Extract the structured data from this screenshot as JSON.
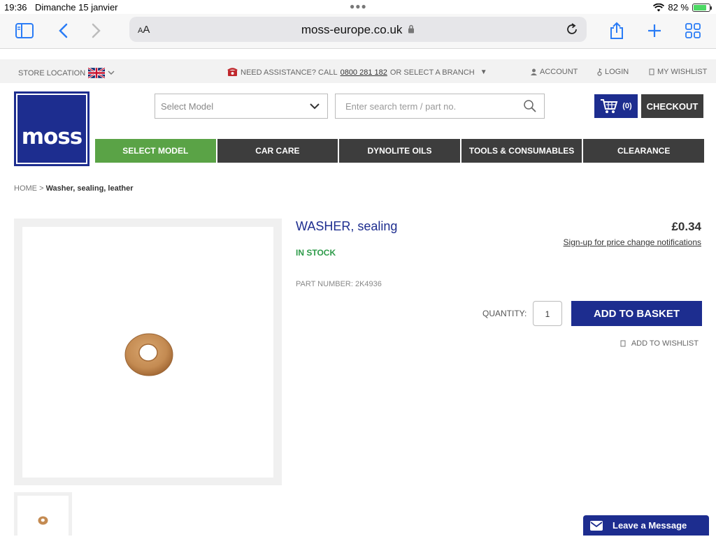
{
  "status": {
    "time": "19:36",
    "date": "Dimanche 15 janvier",
    "battery": "82 %",
    "battery_level": 0.82
  },
  "browser": {
    "text_size": "AA",
    "url": "moss-europe.co.uk"
  },
  "topbar": {
    "store_location": "STORE LOCATION",
    "assistance_prefix": "NEED ASSISTANCE? CALL",
    "phone": "0800 281 182",
    "assistance_suffix": "OR SELECT A BRANCH",
    "account": "ACCOUNT",
    "login": "LOGIN",
    "wishlist": "MY WISHLIST"
  },
  "header": {
    "logo": "moss",
    "select_model_placeholder": "Select Model",
    "search_placeholder": "Enter search term / part no.",
    "cart_count": "(0)",
    "checkout": "CHECKOUT"
  },
  "nav": {
    "items": [
      "SELECT MODEL",
      "CAR CARE",
      "DYNOLITE OILS",
      "TOOLS & CONSUMABLES",
      "CLEARANCE"
    ]
  },
  "breadcrumb": {
    "home": "HOME",
    "sep": ">",
    "current": "Washer, sealing, leather"
  },
  "product": {
    "title": "WASHER, sealing",
    "price": "£0.34",
    "price_notify": "Sign-up for price change notifications",
    "stock": "IN STOCK",
    "part_number": "PART NUMBER: 2K4936",
    "quantity_label": "QUANTITY:",
    "quantity": "1",
    "add_to_basket": "ADD TO BASKET",
    "add_to_wishlist": "ADD TO WISHLIST"
  },
  "chat": {
    "label": "Leave a Message"
  },
  "colors": {
    "brand_blue": "#1d2d8f",
    "nav_dark": "#3d3d3d",
    "nav_active": "#5aa346",
    "stock_green": "#2e9b4a",
    "safari_blue": "#2a7cf6"
  }
}
